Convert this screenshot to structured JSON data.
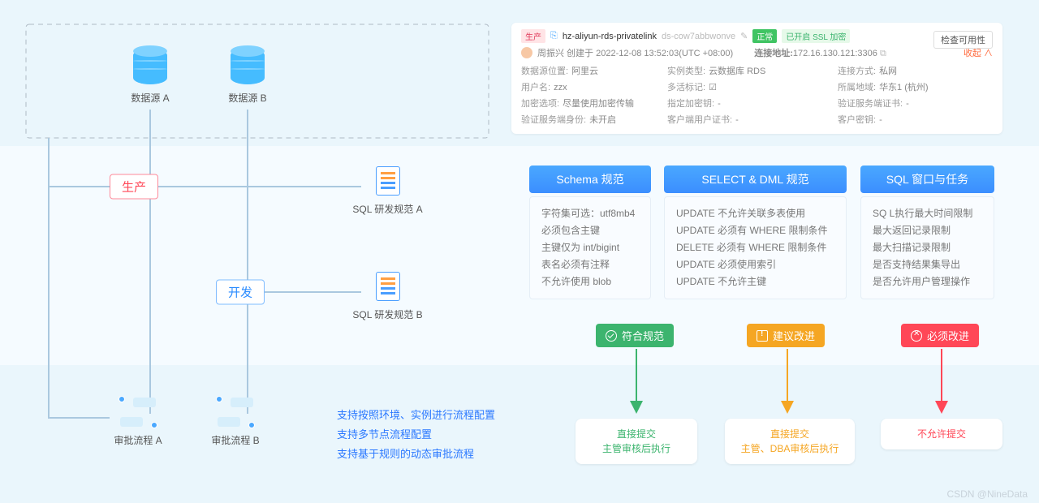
{
  "datasources": {
    "a": "数据源 A",
    "b": "数据源 B"
  },
  "env": {
    "prod": "生产",
    "dev": "开发"
  },
  "sql_spec": {
    "a": "SQL 研发规范 A",
    "b": "SQL 研发规范 B"
  },
  "approve": {
    "a": "审批流程 A",
    "b": "审批流程 B"
  },
  "panel": {
    "env_tag": "生产",
    "name": "hz-aliyun-rds-privatelink",
    "id": "ds-cow7abbwonve",
    "status": "正常",
    "ssl": "已开启 SSL 加密",
    "check_btn": "检查可用性",
    "creator_line": "周振兴 创建于 2022-12-08 13:52:03(UTC +08:00)",
    "addr_k": "连接地址:",
    "addr_v": "172.16.130.121:3306",
    "collapse": "收起 ∧",
    "kv": [
      [
        "数据源位置:",
        "阿里云"
      ],
      [
        "实例类型:",
        "云数据库 RDS"
      ],
      [
        "连接方式:",
        "私网"
      ],
      [
        "用户名:",
        "zzx"
      ],
      [
        "多活标记:",
        "☑"
      ],
      [
        "所属地域:",
        "华东1 (杭州)"
      ],
      [
        "加密选项:",
        "尽量使用加密传输"
      ],
      [
        "指定加密钥:",
        "-"
      ],
      [
        "验证服务端证书:",
        "-"
      ],
      [
        "验证服务端身份:",
        "未开启"
      ],
      [
        "客户端用户证书:",
        "-"
      ],
      [
        "客户密钥:",
        "-"
      ]
    ]
  },
  "columns": {
    "schema": {
      "title": "Schema 规范",
      "items": [
        "字符集可选：utf8mb4",
        "必须包含主键",
        "主键仅为 int/bigint",
        "表名必须有注释",
        "不允许使用 blob"
      ]
    },
    "dml": {
      "title": "SELECT & DML 规范",
      "items": [
        "UPDATE 不允许关联多表使用",
        "UPDATE 必须有 WHERE 限制条件",
        "DELETE 必须有 WHERE 限制条件",
        "UPDATE 必须使用索引",
        "UPDATE 不允许主键"
      ]
    },
    "window": {
      "title": "SQL 窗口与任务",
      "items": [
        "SQ L执行最大时间限制",
        "最大返回记录限制",
        "最大扫描记录限制",
        "是否支持结果集导出",
        "是否允许用户管理操作"
      ]
    }
  },
  "badges": {
    "ok": "符合规范",
    "warn": "建议改进",
    "err": "必须改进"
  },
  "results": {
    "ok": [
      "直接提交",
      "主管审核后执行"
    ],
    "warn": [
      "直接提交",
      "主管、DBA审核后执行"
    ],
    "err": [
      "不允许提交"
    ]
  },
  "features": [
    "支持按照环境、实例进行流程配置",
    "支持多节点流程配置",
    "支持基于规则的动态审批流程"
  ],
  "watermark": "CSDN @NineData"
}
